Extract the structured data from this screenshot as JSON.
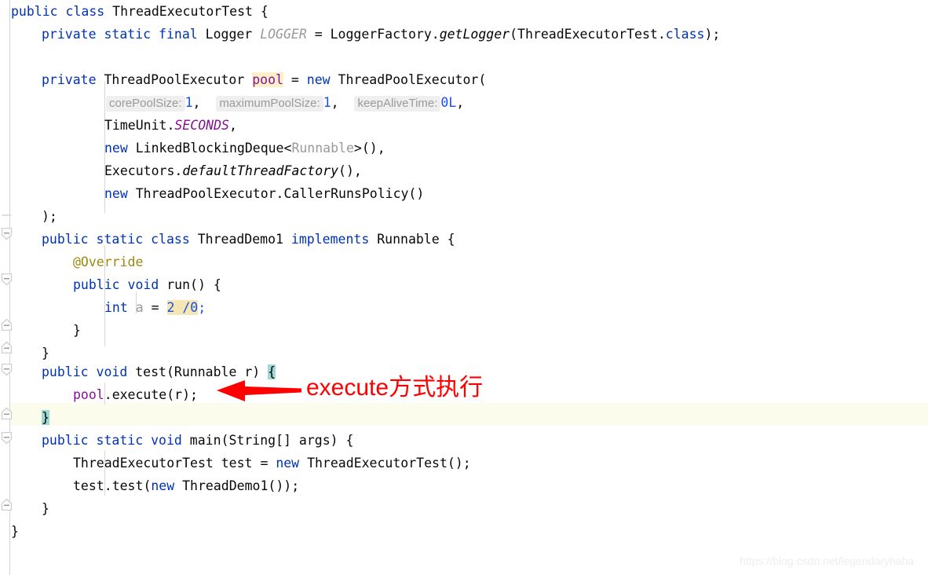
{
  "app": {
    "type": "code-editor",
    "language": "Java",
    "theme": "light"
  },
  "colors": {
    "background": "#ffffff",
    "keyword": "#0033b3",
    "number": "#1750eb",
    "field": "#871094",
    "annotation": "#9e880d",
    "comment_gray": "#999999",
    "identifier_highlight": "#fcf0c9",
    "expression_highlight": "#f6e6b4",
    "brace_match_highlight": "#9fd9d4",
    "current_line": "#fcfcec",
    "gutter_rule": "#d4d4d4",
    "indent_guide": "#d6d6d6",
    "annotation_red": "#ff0000",
    "watermark": "#ededed"
  },
  "code": {
    "lines": [
      {
        "n": 1,
        "indent": 0,
        "text": "public class ThreadExecutorTest {"
      },
      {
        "n": 2,
        "indent": 1,
        "text": "private static final Logger LOGGER = LoggerFactory.getLogger(ThreadExecutorTest.class);"
      },
      {
        "n": 3,
        "indent": 0,
        "text": ""
      },
      {
        "n": 4,
        "indent": 1,
        "text": "private ThreadPoolExecutor pool = new ThreadPoolExecutor("
      },
      {
        "n": 5,
        "indent": 3,
        "text": "corePoolSize: 1, maximumPoolSize: 1, keepAliveTime: 0L,"
      },
      {
        "n": 6,
        "indent": 3,
        "text": "TimeUnit.SECONDS,"
      },
      {
        "n": 7,
        "indent": 3,
        "text": "new LinkedBlockingDeque<Runnable>(),"
      },
      {
        "n": 8,
        "indent": 3,
        "text": "Executors.defaultThreadFactory(),"
      },
      {
        "n": 9,
        "indent": 3,
        "text": "new ThreadPoolExecutor.CallerRunsPolicy()"
      },
      {
        "n": 10,
        "indent": 1,
        "text": ");"
      },
      {
        "n": 11,
        "indent": 1,
        "text": "public static class ThreadDemo1 implements Runnable {"
      },
      {
        "n": 12,
        "indent": 2,
        "text": "@Override"
      },
      {
        "n": 13,
        "indent": 2,
        "text": "public void run() {"
      },
      {
        "n": 14,
        "indent": 3,
        "text": "int a = 2 /0;"
      },
      {
        "n": 15,
        "indent": 2,
        "text": "}"
      },
      {
        "n": 16,
        "indent": 1,
        "text": "}"
      },
      {
        "n": 17,
        "indent": 1,
        "text": "public void test(Runnable r) {"
      },
      {
        "n": 18,
        "indent": 2,
        "text": "pool.execute(r);"
      },
      {
        "n": 19,
        "indent": 1,
        "text": "}"
      },
      {
        "n": 20,
        "indent": 1,
        "text": "public static void main(String[] args) {"
      },
      {
        "n": 21,
        "indent": 2,
        "text": "ThreadExecutorTest test = new ThreadExecutorTest();"
      },
      {
        "n": 22,
        "indent": 2,
        "text": "test.test(new ThreadDemo1());"
      },
      {
        "n": 23,
        "indent": 1,
        "text": "}"
      },
      {
        "n": 24,
        "indent": 0,
        "text": "}"
      }
    ],
    "parameter_hints": [
      {
        "label": "corePoolSize:",
        "value": "1"
      },
      {
        "label": "maximumPoolSize:",
        "value": "1"
      },
      {
        "label": "keepAliveTime:",
        "value": "0L"
      }
    ],
    "highlighted_identifier": "pool",
    "highlighted_expression": "2 /0",
    "matched_braces": [
      "{",
      "}"
    ],
    "current_line_number": 19
  },
  "tokens": {
    "l1": {
      "kw1": "public",
      "kw2": "class",
      "name": "ThreadExecutorTest",
      "brace": "{"
    },
    "l2": {
      "kw1": "private",
      "kw2": "static",
      "kw3": "final",
      "type": "Logger",
      "field": "LOGGER",
      "eq": "=",
      "cls": "LoggerFactory",
      "dot": ".",
      "method": "getLogger",
      "open": "(",
      "arg": "ThreadExecutorTest",
      "dot2": ".",
      "kwclass": "class",
      "close": ");"
    },
    "l4": {
      "kw1": "private",
      "type": "ThreadPoolExecutor",
      "var": "pool",
      "eq": "=",
      "kwnew": "new",
      "ctor": "ThreadPoolExecutor("
    },
    "l6": {
      "cls": "TimeUnit",
      "dot": ".",
      "const": "SECONDS",
      "comma": ","
    },
    "l7": {
      "kwnew": "new",
      "cls": "LinkedBlockingDeque",
      "lt": "<",
      "generic": "Runnable",
      "gt": ">(),"
    },
    "l8": {
      "cls": "Executors",
      "dot": ".",
      "method": "defaultThreadFactory",
      "tail": "(),"
    },
    "l9": {
      "kwnew": "new",
      "cls": "ThreadPoolExecutor.CallerRunsPolicy()"
    },
    "l10": {
      "text": ");"
    },
    "l11": {
      "kw1": "public",
      "kw2": "static",
      "kw3": "class",
      "name": "ThreadDemo1",
      "kw4": "implements",
      "iface": "Runnable",
      "brace": "{"
    },
    "l12": {
      "anno": "@Override"
    },
    "l13": {
      "kw1": "public",
      "kw2": "void",
      "name": "run",
      "tail": "() {"
    },
    "l14": {
      "kw1": "int",
      "var": "a",
      "eq": "=",
      "expr": "2 /0",
      "semi": ";"
    },
    "l15": {
      "brace": "}"
    },
    "l16": {
      "brace": "}"
    },
    "l17": {
      "kw1": "public",
      "kw2": "void",
      "name": "test",
      "open": "(",
      "type": "Runnable",
      "param": "r",
      "close": ")",
      "brace": "{"
    },
    "l18": {
      "field": "pool",
      "dot": ".",
      "method": "execute",
      "args": "(r);"
    },
    "l19": {
      "brace": "}"
    },
    "l20": {
      "kw1": "public",
      "kw2": "static",
      "kw3": "void",
      "name": "main",
      "open": "(",
      "type": "String[]",
      "param": "args",
      "close": ")",
      "brace": "{"
    },
    "l21": {
      "type": "ThreadExecutorTest",
      "var": "test",
      "eq": "=",
      "kwnew": "new",
      "ctor": "ThreadExecutorTest();"
    },
    "l22": {
      "var": "test",
      "dot": ".",
      "method": "test",
      "open": "(",
      "kwnew": "new",
      "ctor": "ThreadDemo1());"
    },
    "l23": {
      "brace": "}"
    },
    "l24": {
      "brace": "}"
    }
  },
  "annotation": {
    "arrow": {
      "direction": "left",
      "color": "#ff0000"
    },
    "text": "execute方式执行"
  },
  "watermark": {
    "text": "https://blog.csdn.net/legendaryhaha"
  },
  "gutter": {
    "fold_marker": "minus",
    "marker_count": 9
  }
}
